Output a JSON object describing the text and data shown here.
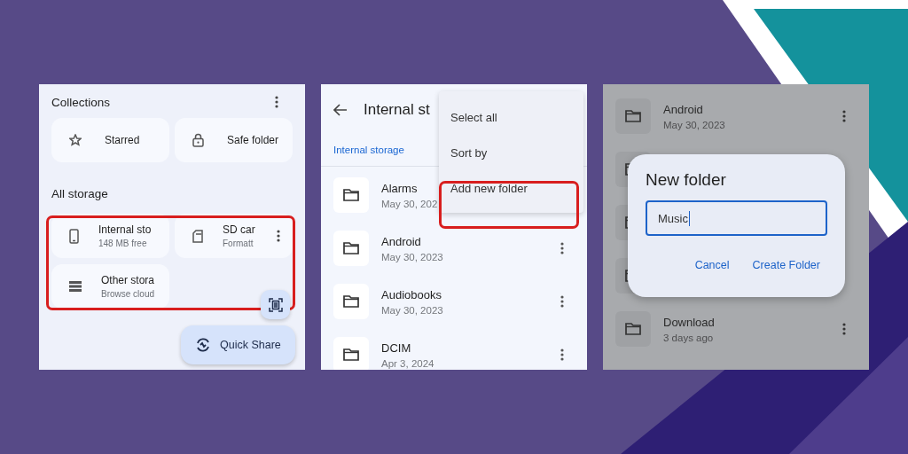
{
  "panels": [
    {
      "kind": "storage",
      "collections_title": "Collections",
      "collections": [
        {
          "label": "Starred"
        },
        {
          "label": "Safe folder"
        }
      ],
      "storage_title": "All storage",
      "storage": [
        {
          "label": "Internal sto",
          "detail": "148 MB free"
        },
        {
          "label": "SD car",
          "detail": "Formatt",
          "menu": true
        },
        {
          "label": "Other stora",
          "detail": "Browse cloud"
        }
      ],
      "highlighted": true,
      "fab_label": "Quick Share"
    },
    {
      "kind": "folder_list",
      "title": "Internal st",
      "breadcrumb": "Internal storage",
      "rows": [
        {
          "kind": "folder",
          "name": "Alarms",
          "date": "May 30, 202"
        },
        {
          "kind": "folder",
          "name": "Android",
          "date": "May 30, 2023",
          "menu": true
        },
        {
          "kind": "folder",
          "name": "Audiobooks",
          "date": "May 30, 2023",
          "menu": true
        },
        {
          "kind": "folder",
          "name": "DCIM",
          "date": "Apr 3, 2024",
          "menu": true
        }
      ],
      "menu": [
        {
          "label": "Select all",
          "highlighted": false
        },
        {
          "label": "Sort by",
          "highlighted": false
        },
        {
          "label": "Add new folder",
          "highlighted": true
        }
      ]
    },
    {
      "kind": "dialog",
      "rows": [
        {
          "kind": "folder",
          "name": "Android",
          "date": "May 30, 2023",
          "menu": true
        },
        {
          "kind": "covered"
        },
        {
          "kind": "covered"
        },
        {
          "kind": "covered"
        },
        {
          "kind": "folder",
          "name": "Download",
          "date": "3 days ago",
          "menu": true
        }
      ],
      "dialog": {
        "title": "New folder",
        "value": "Music",
        "buttons": [
          "Cancel",
          "Create Folder"
        ]
      }
    }
  ]
}
